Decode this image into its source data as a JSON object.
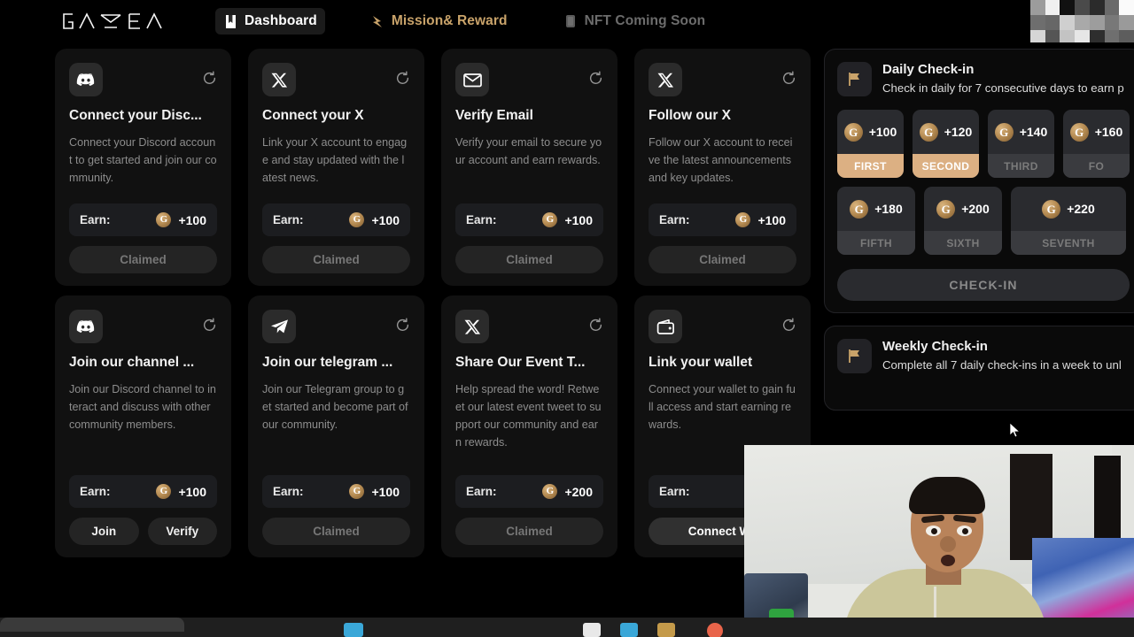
{
  "nav": {
    "logo_text": "GAEA",
    "items": [
      {
        "label": "Dashboard",
        "icon": "book-icon",
        "state": "active"
      },
      {
        "label": "Mission& Reward",
        "icon": "lightning-icon",
        "state": "accent"
      },
      {
        "label": "NFT Coming Soon",
        "icon": "nft-card-icon",
        "state": "disabled"
      }
    ]
  },
  "colors": {
    "accent_gold": "#c9a36a",
    "tile_active": "#dcb083",
    "card_bg": "#111111",
    "page_bg": "#000000"
  },
  "tasks": [
    {
      "icon": "discord-icon",
      "title": "Connect your Disc...",
      "description": "Connect your Discord account to get started and join our community.",
      "earn_label": "Earn:",
      "earn_value": "+100",
      "buttons": [
        {
          "label": "Claimed",
          "style": "claimed"
        }
      ]
    },
    {
      "icon": "x-icon",
      "title": "Connect your X",
      "description": "Link your X account to engage and stay updated with the latest news.",
      "earn_label": "Earn:",
      "earn_value": "+100",
      "buttons": [
        {
          "label": "Claimed",
          "style": "claimed"
        }
      ]
    },
    {
      "icon": "envelope-icon",
      "title": "Verify Email",
      "description": "Verify your email to secure your account and earn rewards.",
      "earn_label": "Earn:",
      "earn_value": "+100",
      "buttons": [
        {
          "label": "Claimed",
          "style": "claimed"
        }
      ]
    },
    {
      "icon": "x-icon",
      "title": "Follow our X",
      "description": "Follow our X account to receive the latest announcements and key updates.",
      "earn_label": "Earn:",
      "earn_value": "+100",
      "buttons": [
        {
          "label": "Claimed",
          "style": "claimed"
        }
      ]
    },
    {
      "icon": "discord-icon",
      "title": "Join our channel ...",
      "description": "Join our Discord channel to interact and discuss with other community members.",
      "earn_label": "Earn:",
      "earn_value": "+100",
      "buttons": [
        {
          "label": "Join",
          "style": "solid"
        },
        {
          "label": "Verify",
          "style": "solid"
        }
      ]
    },
    {
      "icon": "telegram-icon",
      "title": "Join our telegram ...",
      "description": "Join our Telegram group to get started and become part of our community.",
      "earn_label": "Earn:",
      "earn_value": "+100",
      "buttons": [
        {
          "label": "Claimed",
          "style": "claimed"
        }
      ]
    },
    {
      "icon": "x-icon",
      "title": "Share Our Event T...",
      "description": "Help spread the word! Retweet our latest event tweet to support our community and earn rewards.",
      "earn_label": "Earn:",
      "earn_value": "+200",
      "buttons": [
        {
          "label": "Claimed",
          "style": "claimed"
        }
      ]
    },
    {
      "icon": "wallet-icon",
      "title": "Link your wallet",
      "description": "Connect your wallet to gain full access and start earning rewards.",
      "earn_label": "Earn:",
      "earn_value": "",
      "buttons": [
        {
          "label": "Connect Wa",
          "style": "primary"
        }
      ]
    }
  ],
  "daily_checkin": {
    "icon": "flag-icon",
    "title": "Daily Check-in",
    "subtitle": "Check in daily for 7 consecutive days to earn p",
    "tiles": [
      {
        "amount": "+100",
        "day": "FIRST",
        "state": "active"
      },
      {
        "amount": "+120",
        "day": "SECOND",
        "state": "active"
      },
      {
        "amount": "+140",
        "day": "THIRD",
        "state": "idle"
      },
      {
        "amount": "+160",
        "day": "FO",
        "state": "idle"
      },
      {
        "amount": "+180",
        "day": "FIFTH",
        "state": "idle"
      },
      {
        "amount": "+200",
        "day": "SIXTH",
        "state": "idle"
      },
      {
        "amount": "+220",
        "day": "SEVENTH",
        "state": "idle"
      }
    ],
    "button_label": "CHECK-IN"
  },
  "weekly_checkin": {
    "icon": "flag-icon",
    "title": "Weekly Check-in",
    "subtitle": "Complete all 7 daily check-ins in a week to unl"
  }
}
